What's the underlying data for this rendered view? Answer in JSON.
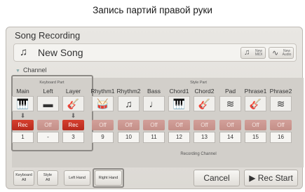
{
  "caption": "Запись партий правой руки",
  "panel": {
    "title": "Song Recording",
    "song_name": "New Song",
    "new_midi": {
      "l1": "New",
      "l2": "MIDI"
    },
    "new_audio": {
      "l1": "New",
      "l2": "Audio"
    },
    "channel_label": "Channel"
  },
  "headers": {
    "keyboard_part": "Keyboard Part",
    "style_part": "Style Part",
    "recording_channel": "Recording Channel"
  },
  "parts": [
    {
      "name": "Main",
      "icon": "piano-icon",
      "glyph": "🎹",
      "arrow": "⬇",
      "state": "Rec",
      "channel": "1"
    },
    {
      "name": "Left",
      "icon": "keyboard-icon",
      "glyph": "▬",
      "arrow": "",
      "state": "Off",
      "channel": "-"
    },
    {
      "name": "Layer",
      "icon": "guitar-icon",
      "glyph": "🎸",
      "arrow": "⬇",
      "state": "Rec",
      "channel": "3"
    },
    {
      "name": "Rhythm1",
      "icon": "drums-icon",
      "glyph": "🥁",
      "arrow": "",
      "state": "Off",
      "channel": "9"
    },
    {
      "name": "Rhythm2",
      "icon": "percussion-icon",
      "glyph": "♫",
      "arrow": "",
      "state": "Off",
      "channel": "10"
    },
    {
      "name": "Bass",
      "icon": "bass-icon",
      "glyph": "♩",
      "arrow": "",
      "state": "Off",
      "channel": "11"
    },
    {
      "name": "Chord1",
      "icon": "piano-icon",
      "glyph": "🎹",
      "arrow": "",
      "state": "Off",
      "channel": "12"
    },
    {
      "name": "Chord2",
      "icon": "guitar-icon",
      "glyph": "🎸",
      "arrow": "",
      "state": "Off",
      "channel": "13"
    },
    {
      "name": "Pad",
      "icon": "pad-icon",
      "glyph": "≋",
      "arrow": "",
      "state": "Off",
      "channel": "14"
    },
    {
      "name": "Phrase1",
      "icon": "guitar-icon",
      "glyph": "🎸",
      "arrow": "",
      "state": "Off",
      "channel": "15"
    },
    {
      "name": "Phrase2",
      "icon": "pad-icon",
      "glyph": "≋",
      "arrow": "",
      "state": "Off",
      "channel": "16"
    }
  ],
  "buttons": {
    "keyboard_all": {
      "l1": "Keyboard",
      "l2": "All"
    },
    "style_all": {
      "l1": "Style",
      "l2": "All"
    },
    "left_hand": "Left Hand",
    "right_hand": "Right Hand",
    "cancel": "Cancel",
    "rec_start": "▶ Rec Start"
  }
}
